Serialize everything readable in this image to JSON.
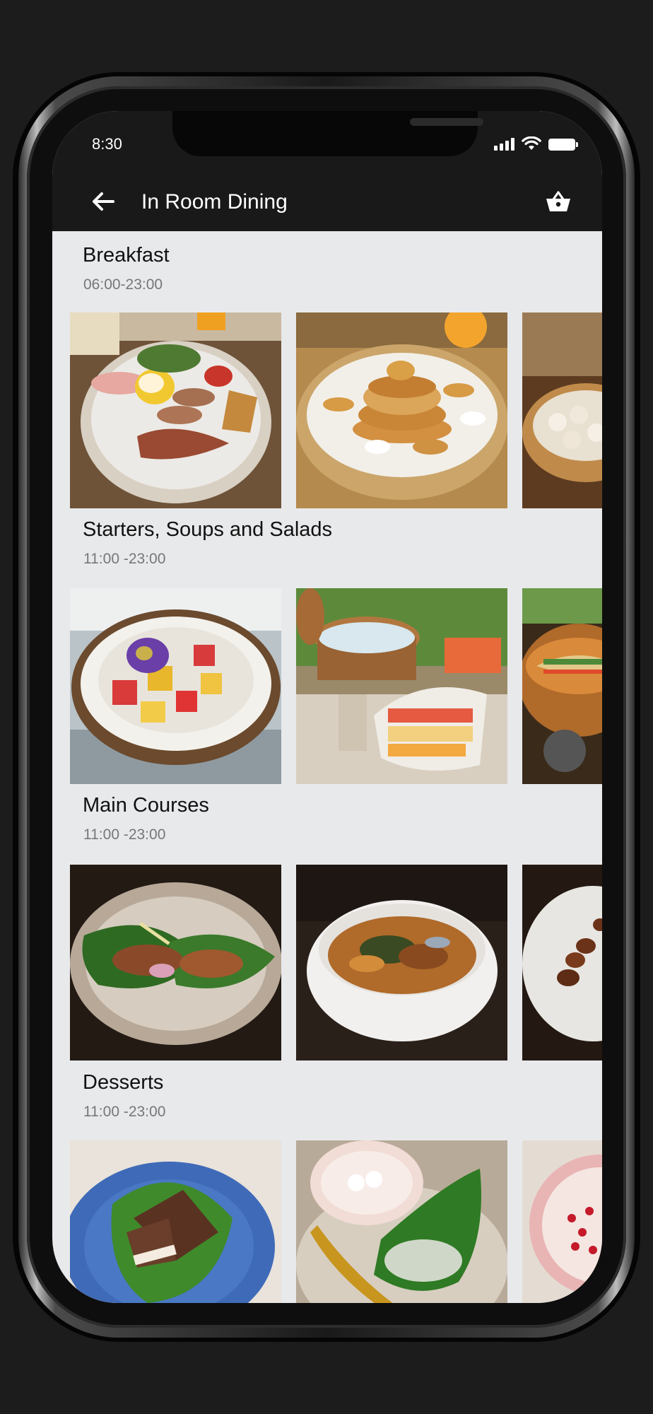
{
  "status_bar": {
    "time": "8:30"
  },
  "header": {
    "title": "In Room Dining",
    "back_icon": "arrow-left-icon",
    "cart_icon": "basket-icon"
  },
  "sections": [
    {
      "title": "Breakfast",
      "hours": "06:00-23:00",
      "images": [
        "full-english-breakfast-photo",
        "pancake-stack-photo",
        "dim-sum-steamer-photo"
      ]
    },
    {
      "title": "Starters, Soups and Salads",
      "hours": "11:00 -23:00",
      "images": [
        "coconut-fruit-salad-photo",
        "fruit-buffet-photo",
        "noodle-soup-pot-photo"
      ]
    },
    {
      "title": "Main Courses",
      "hours": "11:00 -23:00",
      "images": [
        "betel-leaf-wrap-photo",
        "curry-bowl-photo",
        "grilled-skewers-photo"
      ]
    },
    {
      "title": "Desserts",
      "hours": "11:00 -23:00",
      "images": [
        "sticky-rice-dessert-photo",
        "coconut-cream-dessert-photo",
        "pomegranate-dessert-photo"
      ]
    }
  ]
}
